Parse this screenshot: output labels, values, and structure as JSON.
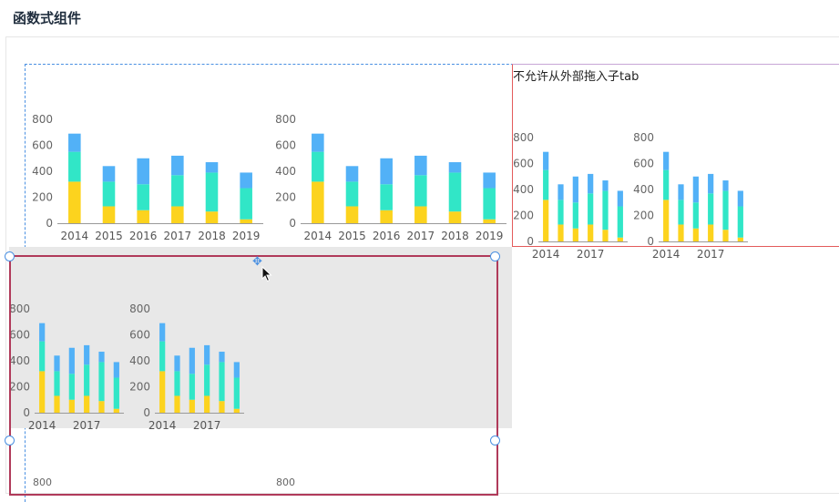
{
  "page": {
    "title": "函数式组件"
  },
  "drop_zone_note": "不允许从外部拖入子tab",
  "overflow_labels": [
    "800",
    "800"
  ],
  "chart_data": [
    {
      "type": "bar",
      "stacked": true,
      "categories": [
        "2014",
        "2015",
        "2016",
        "2017",
        "2018",
        "2019"
      ],
      "series": [
        {
          "values": [
            320,
            130,
            100,
            130,
            90,
            30
          ],
          "color": "#fcd31e"
        },
        {
          "values": [
            230,
            190,
            200,
            240,
            300,
            240
          ],
          "color": "#31e6c7"
        },
        {
          "values": [
            140,
            120,
            200,
            150,
            80,
            120
          ],
          "color": "#52b1f7"
        }
      ],
      "y_ticks": [
        "0",
        "200",
        "400",
        "600",
        "800"
      ],
      "ylim": [
        0,
        800
      ],
      "x_labels_shown": [
        "2014",
        "2015",
        "2016",
        "2017",
        "2018",
        "2019"
      ]
    },
    {
      "type": "bar",
      "stacked": true,
      "categories": [
        "2014",
        "2015",
        "2016",
        "2017",
        "2018",
        "2019"
      ],
      "series": [
        {
          "values": [
            320,
            130,
            100,
            130,
            90,
            30
          ],
          "color": "#fcd31e"
        },
        {
          "values": [
            230,
            190,
            200,
            240,
            300,
            240
          ],
          "color": "#31e6c7"
        },
        {
          "values": [
            140,
            120,
            200,
            150,
            80,
            120
          ],
          "color": "#52b1f7"
        }
      ],
      "y_ticks": [
        "0",
        "200",
        "400",
        "600",
        "800"
      ],
      "ylim": [
        0,
        800
      ],
      "x_labels_shown": [
        "2014",
        "2015",
        "2016",
        "2017",
        "2018",
        "2019"
      ]
    },
    {
      "type": "bar",
      "stacked": true,
      "categories": [
        "2014",
        "2015",
        "2016",
        "2017",
        "2018",
        "2019"
      ],
      "series": [
        {
          "values": [
            320,
            130,
            100,
            130,
            90,
            30
          ],
          "color": "#fcd31e"
        },
        {
          "values": [
            230,
            190,
            200,
            240,
            300,
            240
          ],
          "color": "#31e6c7"
        },
        {
          "values": [
            140,
            120,
            200,
            150,
            80,
            120
          ],
          "color": "#52b1f7"
        }
      ],
      "y_ticks": [
        "0",
        "200",
        "400",
        "600",
        "800"
      ],
      "ylim": [
        0,
        800
      ],
      "x_labels_shown": [
        "2014",
        "2017"
      ]
    },
    {
      "type": "bar",
      "stacked": true,
      "categories": [
        "2014",
        "2015",
        "2016",
        "2017",
        "2018",
        "2019"
      ],
      "series": [
        {
          "values": [
            320,
            130,
            100,
            130,
            90,
            30
          ],
          "color": "#fcd31e"
        },
        {
          "values": [
            230,
            190,
            200,
            240,
            300,
            240
          ],
          "color": "#31e6c7"
        },
        {
          "values": [
            140,
            120,
            200,
            150,
            80,
            120
          ],
          "color": "#52b1f7"
        }
      ],
      "y_ticks": [
        "0",
        "200",
        "400",
        "600",
        "800"
      ],
      "ylim": [
        0,
        800
      ],
      "x_labels_shown": [
        "2014",
        "2017"
      ]
    },
    {
      "type": "bar",
      "stacked": true,
      "categories": [
        "2014",
        "2015",
        "2016",
        "2017",
        "2018",
        "2019"
      ],
      "series": [
        {
          "values": [
            320,
            130,
            100,
            130,
            90,
            30
          ],
          "color": "#fcd31e"
        },
        {
          "values": [
            230,
            190,
            200,
            240,
            300,
            240
          ],
          "color": "#31e6c7"
        },
        {
          "values": [
            140,
            120,
            200,
            150,
            80,
            120
          ],
          "color": "#52b1f7"
        }
      ],
      "y_ticks": [
        "0",
        "200",
        "400",
        "600",
        "800"
      ],
      "ylim": [
        0,
        800
      ],
      "x_labels_shown": [
        "2014",
        "2017"
      ]
    },
    {
      "type": "bar",
      "stacked": true,
      "categories": [
        "2014",
        "2015",
        "2016",
        "2017",
        "2018",
        "2019"
      ],
      "series": [
        {
          "values": [
            320,
            130,
            100,
            130,
            90,
            30
          ],
          "color": "#fcd31e"
        },
        {
          "values": [
            230,
            190,
            200,
            240,
            300,
            240
          ],
          "color": "#31e6c7"
        },
        {
          "values": [
            140,
            120,
            200,
            150,
            80,
            120
          ],
          "color": "#52b1f7"
        }
      ],
      "y_ticks": [
        "0",
        "200",
        "400",
        "600",
        "800"
      ],
      "ylim": [
        0,
        800
      ],
      "x_labels_shown": [
        "2014",
        "2017"
      ]
    }
  ]
}
